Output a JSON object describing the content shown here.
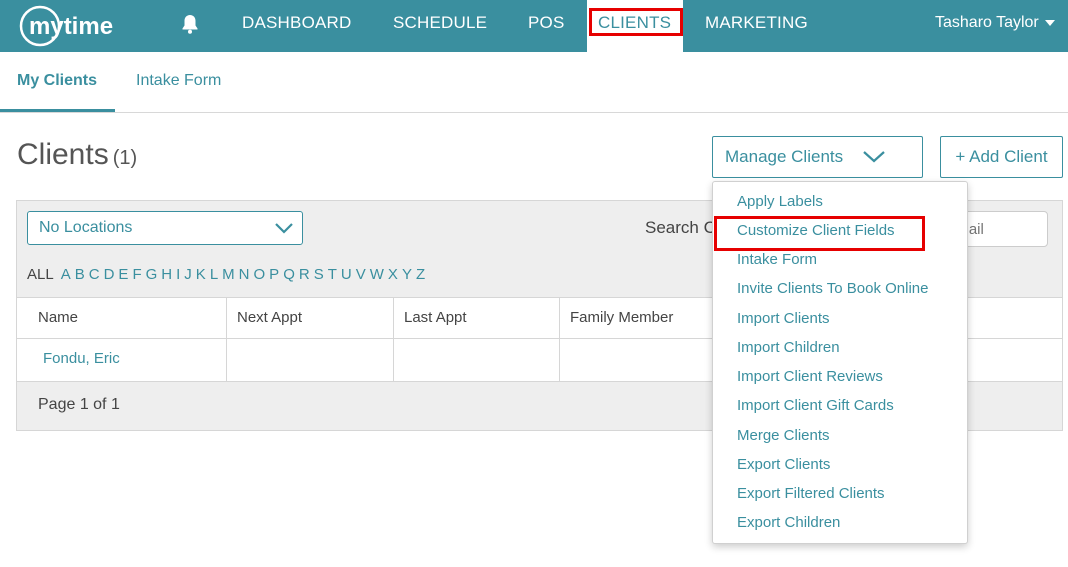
{
  "colors": {
    "primary": "#3a8f9f",
    "highlight": "#e60000",
    "nav_text": "#ffffff"
  },
  "nav": {
    "logo_text": "mytime",
    "bell_icon": "bell-icon",
    "items": [
      "DASHBOARD",
      "SCHEDULE",
      "POS",
      "CLIENTS",
      "MARKETING"
    ],
    "active": "CLIENTS",
    "user": "Tasharo Taylor"
  },
  "subtabs": [
    "My Clients",
    "Intake Form"
  ],
  "page": {
    "title": "Clients",
    "count": "(1)"
  },
  "buttons": {
    "manage": "Manage Clients",
    "add": "+ Add Client"
  },
  "filters": {
    "location": "No Locations",
    "search_label": "Search C",
    "search_placeholder": "email",
    "alpha_all": "ALL",
    "letters": [
      "A",
      "B",
      "C",
      "D",
      "E",
      "F",
      "G",
      "H",
      "I",
      "J",
      "K",
      "L",
      "M",
      "N",
      "O",
      "P",
      "Q",
      "R",
      "S",
      "T",
      "U",
      "V",
      "W",
      "X",
      "Y",
      "Z"
    ]
  },
  "table": {
    "headers": [
      "Name",
      "Next Appt",
      "Last Appt",
      "Family Member"
    ],
    "rows": [
      [
        "Fondu, Eric",
        "",
        "",
        ""
      ]
    ],
    "pager": "Page 1 of 1"
  },
  "manage_menu": [
    "Apply Labels",
    "Customize Client Fields",
    "Intake Form",
    "Invite Clients To Book Online",
    "Import Clients",
    "Import Children",
    "Import Client Reviews",
    "Import Client Gift Cards",
    "Merge Clients",
    "Export Clients",
    "Export Filtered Clients",
    "Export Children"
  ],
  "highlighted_menu_item": "Customize Client Fields"
}
